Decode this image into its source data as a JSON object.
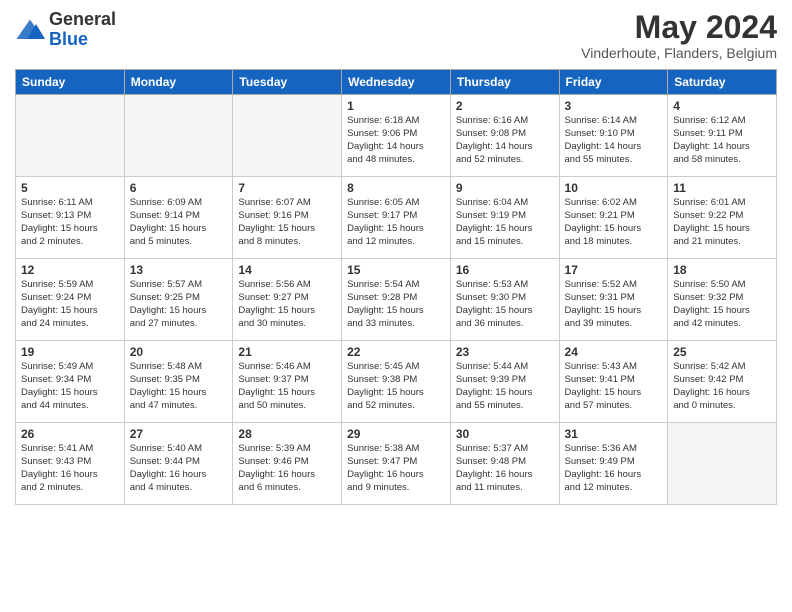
{
  "header": {
    "logo_general": "General",
    "logo_blue": "Blue",
    "month_title": "May 2024",
    "location": "Vinderhoute, Flanders, Belgium"
  },
  "weekdays": [
    "Sunday",
    "Monday",
    "Tuesday",
    "Wednesday",
    "Thursday",
    "Friday",
    "Saturday"
  ],
  "weeks": [
    [
      {
        "day": "",
        "detail": ""
      },
      {
        "day": "",
        "detail": ""
      },
      {
        "day": "",
        "detail": ""
      },
      {
        "day": "1",
        "detail": "Sunrise: 6:18 AM\nSunset: 9:06 PM\nDaylight: 14 hours\nand 48 minutes."
      },
      {
        "day": "2",
        "detail": "Sunrise: 6:16 AM\nSunset: 9:08 PM\nDaylight: 14 hours\nand 52 minutes."
      },
      {
        "day": "3",
        "detail": "Sunrise: 6:14 AM\nSunset: 9:10 PM\nDaylight: 14 hours\nand 55 minutes."
      },
      {
        "day": "4",
        "detail": "Sunrise: 6:12 AM\nSunset: 9:11 PM\nDaylight: 14 hours\nand 58 minutes."
      }
    ],
    [
      {
        "day": "5",
        "detail": "Sunrise: 6:11 AM\nSunset: 9:13 PM\nDaylight: 15 hours\nand 2 minutes."
      },
      {
        "day": "6",
        "detail": "Sunrise: 6:09 AM\nSunset: 9:14 PM\nDaylight: 15 hours\nand 5 minutes."
      },
      {
        "day": "7",
        "detail": "Sunrise: 6:07 AM\nSunset: 9:16 PM\nDaylight: 15 hours\nand 8 minutes."
      },
      {
        "day": "8",
        "detail": "Sunrise: 6:05 AM\nSunset: 9:17 PM\nDaylight: 15 hours\nand 12 minutes."
      },
      {
        "day": "9",
        "detail": "Sunrise: 6:04 AM\nSunset: 9:19 PM\nDaylight: 15 hours\nand 15 minutes."
      },
      {
        "day": "10",
        "detail": "Sunrise: 6:02 AM\nSunset: 9:21 PM\nDaylight: 15 hours\nand 18 minutes."
      },
      {
        "day": "11",
        "detail": "Sunrise: 6:01 AM\nSunset: 9:22 PM\nDaylight: 15 hours\nand 21 minutes."
      }
    ],
    [
      {
        "day": "12",
        "detail": "Sunrise: 5:59 AM\nSunset: 9:24 PM\nDaylight: 15 hours\nand 24 minutes."
      },
      {
        "day": "13",
        "detail": "Sunrise: 5:57 AM\nSunset: 9:25 PM\nDaylight: 15 hours\nand 27 minutes."
      },
      {
        "day": "14",
        "detail": "Sunrise: 5:56 AM\nSunset: 9:27 PM\nDaylight: 15 hours\nand 30 minutes."
      },
      {
        "day": "15",
        "detail": "Sunrise: 5:54 AM\nSunset: 9:28 PM\nDaylight: 15 hours\nand 33 minutes."
      },
      {
        "day": "16",
        "detail": "Sunrise: 5:53 AM\nSunset: 9:30 PM\nDaylight: 15 hours\nand 36 minutes."
      },
      {
        "day": "17",
        "detail": "Sunrise: 5:52 AM\nSunset: 9:31 PM\nDaylight: 15 hours\nand 39 minutes."
      },
      {
        "day": "18",
        "detail": "Sunrise: 5:50 AM\nSunset: 9:32 PM\nDaylight: 15 hours\nand 42 minutes."
      }
    ],
    [
      {
        "day": "19",
        "detail": "Sunrise: 5:49 AM\nSunset: 9:34 PM\nDaylight: 15 hours\nand 44 minutes."
      },
      {
        "day": "20",
        "detail": "Sunrise: 5:48 AM\nSunset: 9:35 PM\nDaylight: 15 hours\nand 47 minutes."
      },
      {
        "day": "21",
        "detail": "Sunrise: 5:46 AM\nSunset: 9:37 PM\nDaylight: 15 hours\nand 50 minutes."
      },
      {
        "day": "22",
        "detail": "Sunrise: 5:45 AM\nSunset: 9:38 PM\nDaylight: 15 hours\nand 52 minutes."
      },
      {
        "day": "23",
        "detail": "Sunrise: 5:44 AM\nSunset: 9:39 PM\nDaylight: 15 hours\nand 55 minutes."
      },
      {
        "day": "24",
        "detail": "Sunrise: 5:43 AM\nSunset: 9:41 PM\nDaylight: 15 hours\nand 57 minutes."
      },
      {
        "day": "25",
        "detail": "Sunrise: 5:42 AM\nSunset: 9:42 PM\nDaylight: 16 hours\nand 0 minutes."
      }
    ],
    [
      {
        "day": "26",
        "detail": "Sunrise: 5:41 AM\nSunset: 9:43 PM\nDaylight: 16 hours\nand 2 minutes."
      },
      {
        "day": "27",
        "detail": "Sunrise: 5:40 AM\nSunset: 9:44 PM\nDaylight: 16 hours\nand 4 minutes."
      },
      {
        "day": "28",
        "detail": "Sunrise: 5:39 AM\nSunset: 9:46 PM\nDaylight: 16 hours\nand 6 minutes."
      },
      {
        "day": "29",
        "detail": "Sunrise: 5:38 AM\nSunset: 9:47 PM\nDaylight: 16 hours\nand 9 minutes."
      },
      {
        "day": "30",
        "detail": "Sunrise: 5:37 AM\nSunset: 9:48 PM\nDaylight: 16 hours\nand 11 minutes."
      },
      {
        "day": "31",
        "detail": "Sunrise: 5:36 AM\nSunset: 9:49 PM\nDaylight: 16 hours\nand 12 minutes."
      },
      {
        "day": "",
        "detail": ""
      }
    ]
  ]
}
